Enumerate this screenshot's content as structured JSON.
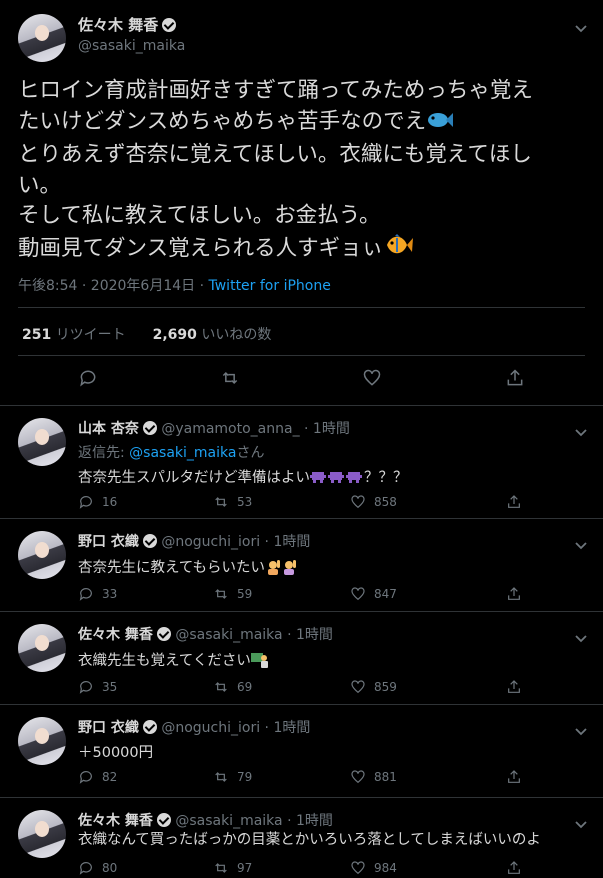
{
  "main": {
    "name": "佐々木 舞香",
    "handle": "@sasaki_maika",
    "text_lines": [
      "ヒロイン育成計画好きすぎて踊ってみためっちゃ覚え",
      "たいけどダンスめちゃめちゃ苦手なのでえ",
      "とりあえず杏奈に覚えてほしい。衣織にも覚えてほし",
      "い。",
      "そして私に教えてほしい。お金払う。",
      "動画見てダンス覚えられる人すギョぃ"
    ],
    "time": "午後8:54 · 2020年6月14日 · ",
    "source": "Twitter for iPhone",
    "retweets_count": "251",
    "retweets_label": "リツイート",
    "likes_count": "2,690",
    "likes_label": "いいねの数"
  },
  "replies": [
    {
      "name": "山本 杏奈",
      "handle": "@yamamoto_anna_",
      "time": "· 1時間",
      "reply_to_label": "返信先: ",
      "reply_to_handle": "@sasaki_maika",
      "reply_to_suffix": "さん",
      "text": "杏奈先生スパルタだけど準備はよい",
      "text_suffix": "？？？",
      "replies": "16",
      "retweets": "53",
      "likes": "858"
    },
    {
      "name": "野口 衣織",
      "handle": "@noguchi_iori",
      "time": "· 1時間",
      "text": "杏奈先生に教えてもらいたい",
      "replies": "33",
      "retweets": "59",
      "likes": "847"
    },
    {
      "name": "佐々木 舞香",
      "handle": "@sasaki_maika",
      "time": "· 1時間",
      "text": "衣織先生も覚えてください",
      "replies": "35",
      "retweets": "69",
      "likes": "859"
    },
    {
      "name": "野口 衣織",
      "handle": "@noguchi_iori",
      "time": "· 1時間",
      "text": "＋50000円",
      "replies": "82",
      "retweets": "79",
      "likes": "881"
    },
    {
      "name": "佐々木 舞香",
      "handle": "@sasaki_maika",
      "time": "· 1時間",
      "text": "衣織なんて買ったばっかの目薬とかいろいろ落としてしまえばいいのよ",
      "replies": "80",
      "retweets": "97",
      "likes": "984"
    }
  ],
  "colors": {
    "background": "#000000",
    "text": "#d9d9d9",
    "muted": "#6e767d",
    "link": "#1da1f2",
    "divider": "#2f3336"
  }
}
